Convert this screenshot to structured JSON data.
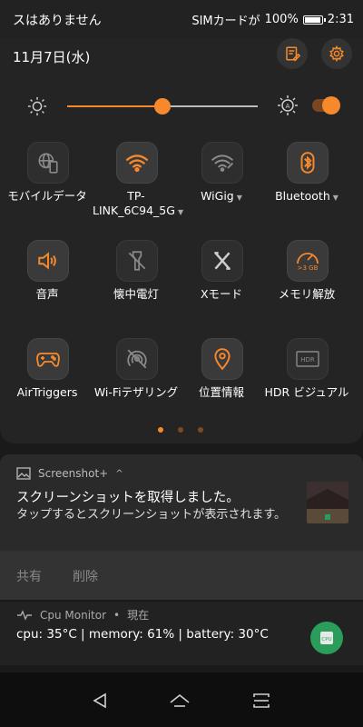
{
  "status_bar": {
    "carrier": "スはありません",
    "sim": "SIMカードが",
    "battery": "100%",
    "battery_level": 1.0,
    "time": "2:31"
  },
  "header": {
    "date": "11月7日(水)"
  },
  "brightness": {
    "level": 0.5,
    "auto_enabled": true
  },
  "quick_tiles": [
    {
      "label": "モバイルデータ",
      "icon": "mobile-data-icon",
      "active": false,
      "has_menu": false
    },
    {
      "label": "TP-LINK_6C94_5G",
      "icon": "wifi-icon",
      "active": true,
      "has_menu": true
    },
    {
      "label": "WiGig",
      "icon": "wigig-icon",
      "active": false,
      "has_menu": true
    },
    {
      "label": "Bluetooth",
      "icon": "bluetooth-icon",
      "active": true,
      "has_menu": true
    },
    {
      "label": "音声",
      "icon": "speaker-icon",
      "active": true,
      "has_menu": false
    },
    {
      "label": "懐中電灯",
      "icon": "flashlight-off-icon",
      "active": false,
      "has_menu": false
    },
    {
      "label": "Xモード",
      "icon": "x-mode-icon",
      "active": false,
      "has_menu": false
    },
    {
      "label": "メモリ解放",
      "icon": "memory-clean-icon",
      "active": true,
      "has_menu": false
    },
    {
      "label": "AirTriggers",
      "icon": "airtriggers-icon",
      "active": true,
      "has_menu": false
    },
    {
      "label": "Wi-Fiテザリング",
      "icon": "hotspot-off-icon",
      "active": false,
      "has_menu": false
    },
    {
      "label": "位置情報",
      "icon": "location-icon",
      "active": true,
      "has_menu": false
    },
    {
      "label": "HDR ビジュアル",
      "icon": "hdr-icon",
      "active": false,
      "has_menu": false
    }
  ],
  "memory_badge": ">3 GB",
  "hdr_badge": "HDR",
  "page_indicator": {
    "count": 3,
    "current": 1
  },
  "notifications": [
    {
      "app": "Screenshot+",
      "title": "スクリーンショットを取得しました。",
      "text": "タップするとスクリーンショットが表示されます。",
      "actions": [
        "共有",
        "削除"
      ]
    },
    {
      "app": "Cpu Monitor",
      "time": "現在",
      "text": "cpu: 35°C | memory: 61% | battery: 30°C",
      "icon_label": "CPU"
    }
  ],
  "colors": {
    "accent": "#f7892d",
    "panel": "#242424",
    "tile_bg": "#2e2e2e"
  }
}
